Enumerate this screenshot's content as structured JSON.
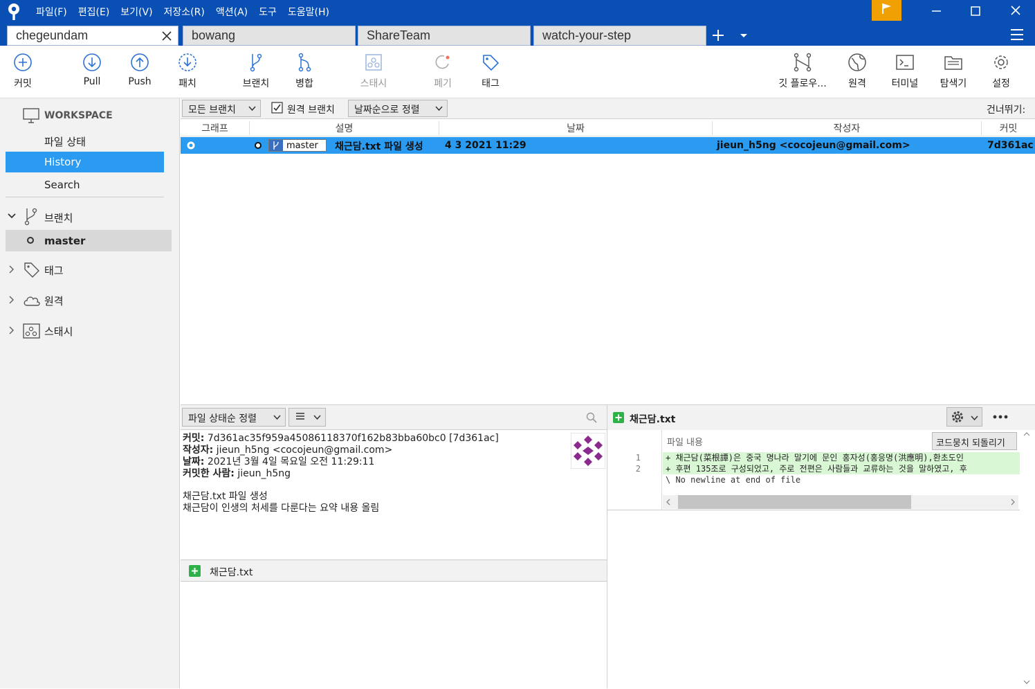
{
  "menu": [
    "파일(F)",
    "편집(E)",
    "보기(V)",
    "저장소(R)",
    "액션(A)",
    "도구",
    "도움말(H)"
  ],
  "tabs": [
    "chegeundam",
    "bowang",
    "ShareTeam",
    "watch-your-step"
  ],
  "toolbar": {
    "commit": "커밋",
    "pull": "Pull",
    "push": "Push",
    "patch": "패치",
    "branch": "브랜치",
    "merge": "병합",
    "stash": "스태시",
    "discard": "폐기",
    "tag": "태그",
    "gitflow": "깃 플로우...",
    "remote": "원격",
    "terminal": "터미널",
    "explorer": "탐색기",
    "settings": "설정"
  },
  "sidebar": {
    "workspace": "WORKSPACE",
    "items": [
      "파일 상태",
      "History",
      "Search"
    ],
    "branches": "브랜치",
    "branch_items": [
      "master"
    ],
    "tags": "태그",
    "remotes": "원격",
    "stashes": "스태시"
  },
  "filter": {
    "all_branches": "모든 브랜치",
    "remote_branches": "원격 브랜치",
    "sort": "날짜순으로 정렬",
    "jump": "건너뛰기:"
  },
  "columns": {
    "graph": "그래프",
    "desc": "설명",
    "date": "날짜",
    "author": "작성자",
    "commit": "커밋"
  },
  "commit_row": {
    "branch": "master",
    "message": "채근담.txt 파일 생성",
    "date": "4 3 2021 11:29",
    "author": "jieun_h5ng <cocojeun@gmail.com>",
    "hash": "7d361ac"
  },
  "details": {
    "sort": "파일 상태순 정렬",
    "commit_label": "커밋:",
    "commit_value": "7d361ac35f959a45086118370f162b83bba60bc0 [7d361ac]",
    "author_label": "작성자:",
    "author_value": "jieun_h5ng <cocojeun@gmail.com>",
    "date_label": "날짜:",
    "date_value": "2021년 3월 4일 목요일 오전 11:29:11",
    "committer_label": "커밋한 사람:",
    "committer_value": "jieun_h5ng",
    "msg1": "채근담.txt 파일 생성",
    "msg2": "채근담이 인생의 처세를 다룬다는 요약 내용 올림",
    "file": "채근담.txt"
  },
  "diff": {
    "file": "채근담.txt",
    "header": "파일 내용",
    "revert": "코드뭉치 되돌리기",
    "lines": [
      {
        "n": "1",
        "t": "+ 채근담(菜根譚)은 중국 명나라 말기에 문인 홍자성(홍응명(洪應明),환초도인"
      },
      {
        "n": "2",
        "t": "+ 후편 135조로 구성되었고, 주로 전편은 사람들과 교류하는 것을 말하였고, 후"
      },
      {
        "n": "",
        "t": "\\  No newline at end of file"
      }
    ]
  },
  "colors": {
    "accent": "#0a4fb3",
    "selection": "#2a9bf0",
    "flag": "#f0a000",
    "added": "#2fb14a"
  }
}
